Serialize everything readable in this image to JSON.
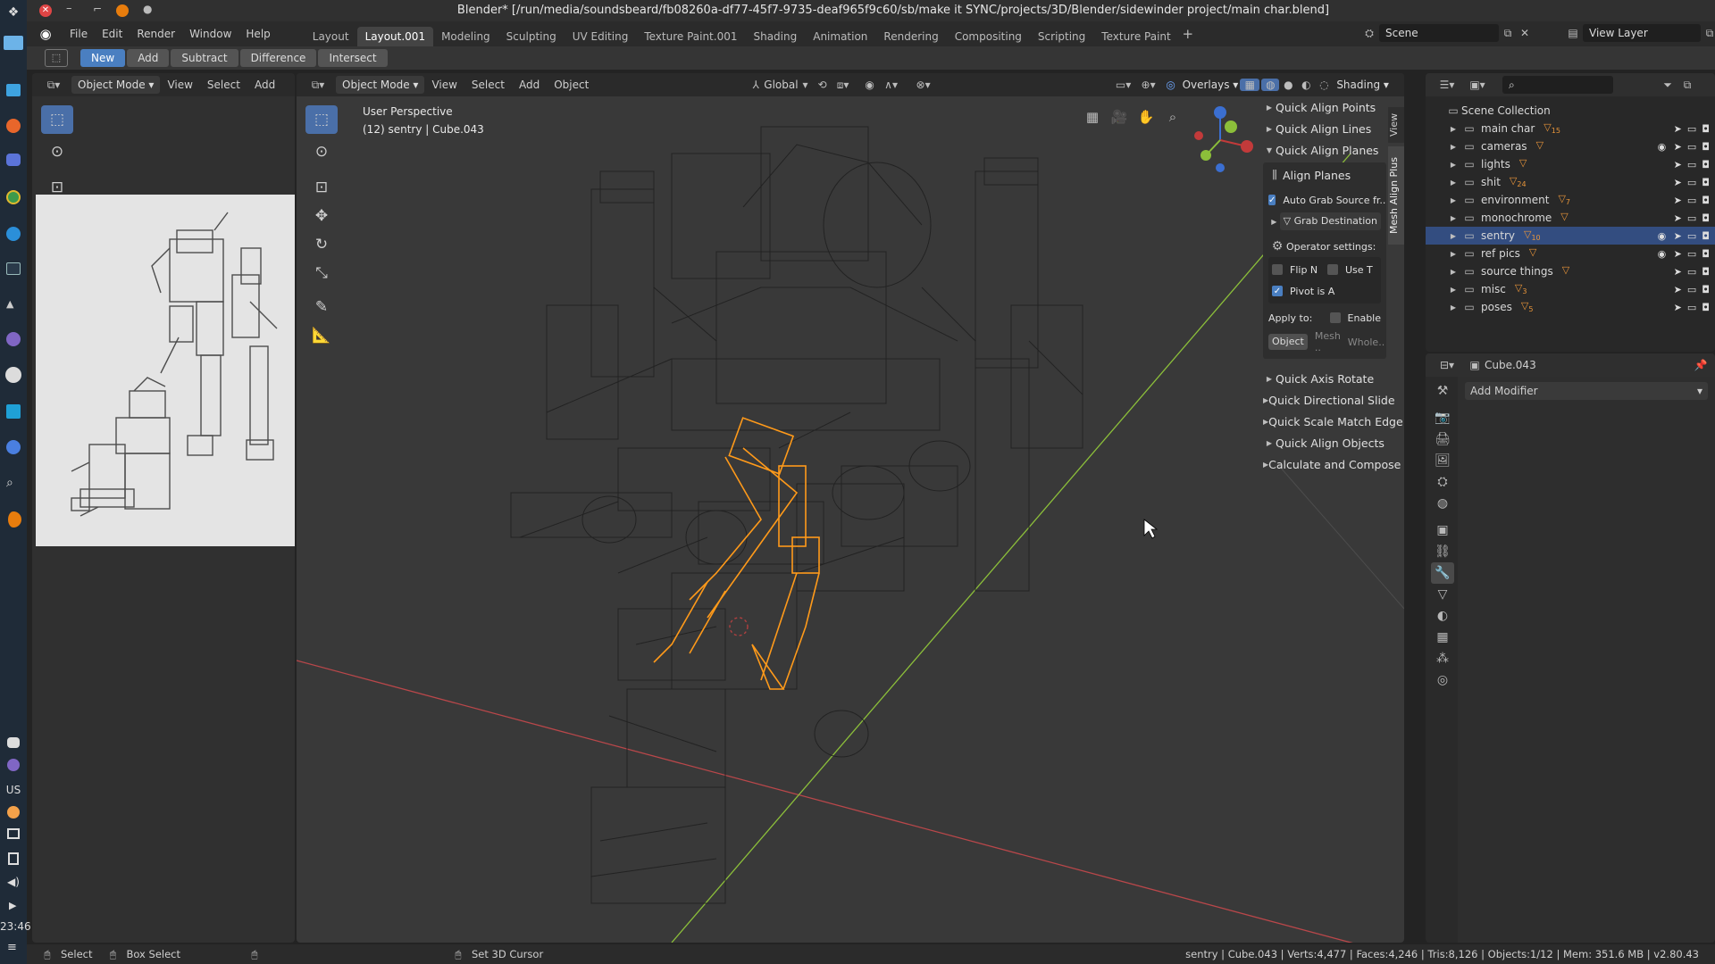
{
  "window": {
    "title": "Blender* [/run/media/soundsbeard/fb08260a-df77-45f7-9735-deaf965f9c60/sb/make it SYNC/projects/3D/Blender/sidewinder project/main char.blend]"
  },
  "menu": [
    "File",
    "Edit",
    "Render",
    "Window",
    "Help"
  ],
  "workspaces": [
    "Layout",
    "Layout.001",
    "Modeling",
    "Sculpting",
    "UV Editing",
    "Texture Paint.001",
    "Shading",
    "Animation",
    "Rendering",
    "Compositing",
    "Scripting",
    "Texture Paint"
  ],
  "workspace_active": "Layout.001",
  "scene": "Scene",
  "view_layer": "View Layer",
  "boolean_bar": [
    "New",
    "Add",
    "Subtract",
    "Difference",
    "Intersect"
  ],
  "left_editor": {
    "mode": "Object Mode",
    "menu": [
      "View",
      "Select",
      "Add"
    ]
  },
  "viewport": {
    "mode": "Object Mode",
    "menu": [
      "View",
      "Select",
      "Add",
      "Object"
    ],
    "orientation": "Global",
    "overlays": "Overlays",
    "shading": "Shading",
    "perspective": "User Perspective",
    "object_info": "(12) sentry | Cube.043",
    "side_tab": "Mesh Align Plus",
    "view_tab": "View"
  },
  "align_panel": {
    "sections_top": [
      "Quick Align Points",
      "Quick Align Lines",
      "Quick Align Planes"
    ],
    "subheader": "Align Planes",
    "auto_grab": "Auto Grab Source fr..",
    "grab_destination": "Grab Destination",
    "operator_settings": "Operator settings:",
    "flip_n": "Flip N",
    "use_t": "Use T",
    "pivot": "Pivot is A",
    "apply_to": "Apply to:",
    "enable": "Enable",
    "targets": [
      "Object",
      "Mesh ..",
      "Whole.."
    ],
    "sections_bottom": [
      "Quick Axis Rotate",
      "Quick Directional Slide",
      "Quick Scale Match Edge",
      "Quick Align Objects",
      "Calculate and Compose"
    ]
  },
  "outliner": {
    "root": "Scene Collection",
    "items": [
      {
        "name": "main char",
        "badge": "15",
        "eye": false,
        "sel": false
      },
      {
        "name": "cameras",
        "badge": "",
        "eye": true,
        "sel": false
      },
      {
        "name": "lights",
        "badge": "",
        "eye": false,
        "sel": false
      },
      {
        "name": "shit",
        "badge": "24",
        "eye": false,
        "sel": false
      },
      {
        "name": "environment",
        "badge": "7",
        "eye": false,
        "sel": false
      },
      {
        "name": "monochrome",
        "badge": "",
        "eye": false,
        "sel": false
      },
      {
        "name": "sentry",
        "badge": "10",
        "eye": true,
        "sel": true
      },
      {
        "name": "ref pics",
        "badge": "",
        "eye": true,
        "sel": false
      },
      {
        "name": "source things",
        "badge": "",
        "eye": false,
        "sel": false
      },
      {
        "name": "misc",
        "badge": "3",
        "eye": false,
        "sel": false
      },
      {
        "name": "poses",
        "badge": "5",
        "eye": false,
        "sel": false
      }
    ]
  },
  "properties": {
    "object": "Cube.043",
    "add_modifier": "Add Modifier"
  },
  "statusbar": {
    "select": "Select",
    "box_select": "Box Select",
    "cursor": "Set 3D Cursor",
    "stats": "sentry | Cube.043 | Verts:4,477 | Faces:4,246 | Tris:8,126 | Objects:1/12 | Mem: 351.6 MB | v2.80.43"
  },
  "taskbar": {
    "clock": "23:46",
    "lang": "US"
  },
  "colors": {
    "accent": "#4a7fc1",
    "selection": "#ff9a1a",
    "x_axis": "#c23a3a",
    "y_axis": "#8cbf3a",
    "z_axis": "#3b6fd1"
  }
}
